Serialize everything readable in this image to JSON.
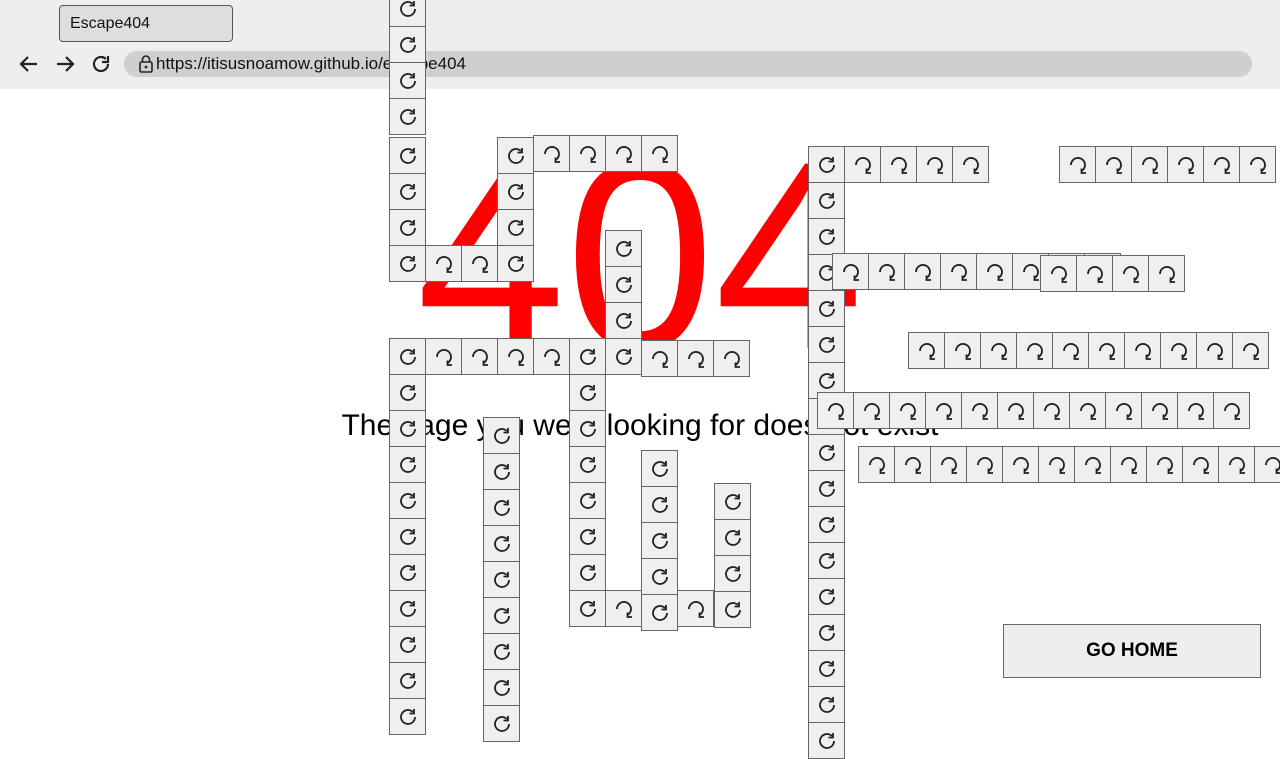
{
  "browser": {
    "tab_title": "Escape404",
    "url": "https://itisusnoamow.github.io/escape404",
    "back_icon": "arrow-left-icon",
    "forward_icon": "arrow-right-icon",
    "reload_icon": "reload-icon",
    "lock_icon": "lock-icon"
  },
  "page": {
    "code": "404",
    "message": "The page you were looking for does not exist",
    "home_button": "GO HOME",
    "code_color": "#ff0000"
  },
  "tiles": {
    "icon": "rotate-icon"
  }
}
